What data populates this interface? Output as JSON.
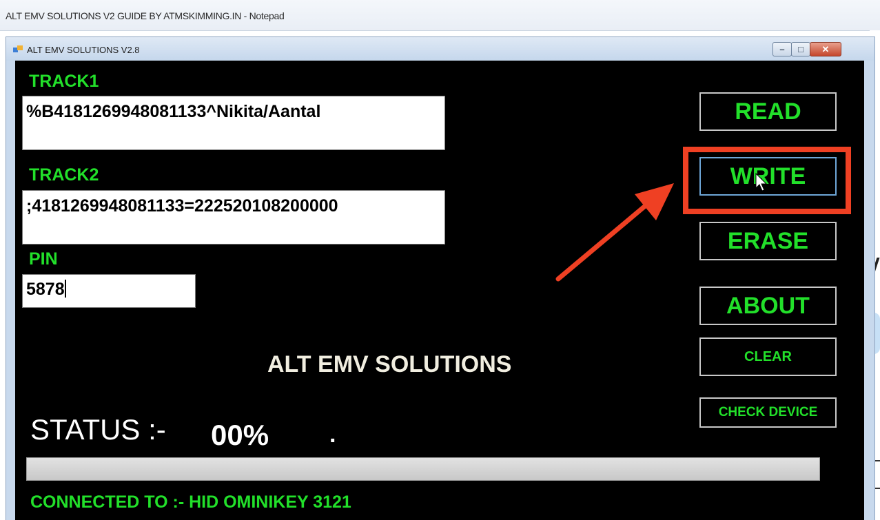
{
  "notepad": {
    "title": "ALT EMV SOLUTIONS V2 GUIDE BY ATMSKIMMING.IN - Notepad"
  },
  "window": {
    "title": "ALT EMV SOLUTIONS V2.8",
    "controls": {
      "minimize": "–",
      "maximize": "□",
      "close": "✕"
    }
  },
  "form": {
    "track1_label": "TRACK1",
    "track1_value": "%B4181269948081133^Nikita/Aantal",
    "track2_label": "TRACK2",
    "track2_value": ";4181269948081133=222520108200000",
    "pin_label": "PIN",
    "pin_value": "5878"
  },
  "buttons": {
    "read": "READ",
    "write": "WRITE",
    "erase": "ERASE",
    "about": "ABOUT",
    "clear": "CLEAR",
    "check_device": "CHECK DEVICE"
  },
  "brand": "ALT EMV SOLUTIONS",
  "status": {
    "label": "STATUS :-",
    "value": "00%",
    "dot": ".",
    "progress_fraction": 0
  },
  "connection": "CONNECTED TO :- HID OMINIKEY 3121",
  "colors": {
    "label_green": "#22e02a",
    "client_bg": "#000000",
    "highlight_red": "#ef4023"
  },
  "annotations": {
    "highlight_target": "write-button",
    "arrow_icon": "red-arrow-icon",
    "cursor_icon": "mouse-cursor-icon"
  }
}
